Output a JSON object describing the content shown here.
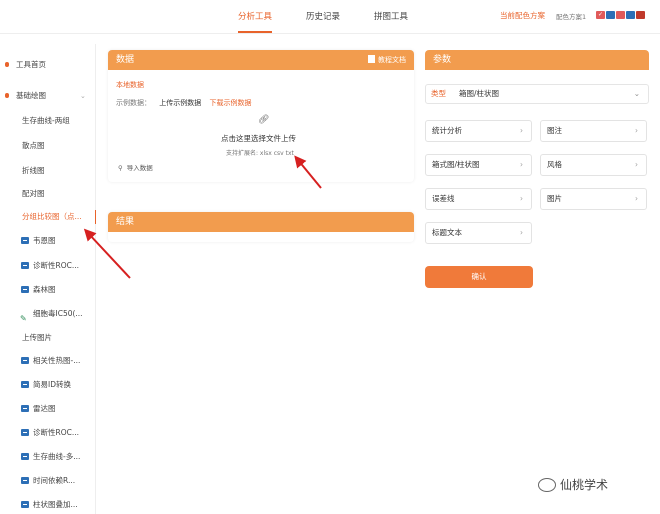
{
  "topnav": {
    "tabs": [
      "分析工具",
      "历史记录",
      "拼图工具"
    ],
    "active_tab": "分析工具",
    "scheme_link": "当前配色方案",
    "scheme_label": "配色方案1",
    "swatch_colors": [
      "#e05a5a",
      "#2d6fb6",
      "#e05a5a",
      "#2d6fb6",
      "#c0392b"
    ]
  },
  "sidebar": {
    "home": "工具首页",
    "group": "基础绘图",
    "items": [
      "生存曲线-两组",
      "散点图",
      "折线图",
      "配对图",
      "分组比较图（点...",
      "韦恩图",
      "诊断性ROC...",
      "森林图",
      "细胞毒IC50(...",
      "上传图片",
      "相关性热图-...",
      "简易ID转换",
      "雷达图",
      "诊断性ROC...",
      "生存曲线-多...",
      "时间依赖R...",
      "柱状图叠加..."
    ]
  },
  "data_panel": {
    "title": "数据",
    "docs": "教程文档",
    "local_data": "本地数据",
    "sample_label": "示例数据：",
    "upload_sample": "上传示例数据",
    "download_sample": "下载示例数据",
    "upload_text": "点击这里选择文件上传",
    "ext_text": "支持扩展名: xlsx csv txt",
    "import": "导入数据"
  },
  "result_panel": {
    "title": "结果"
  },
  "params_panel": {
    "title": "参数",
    "type_label": "类型",
    "type_value": "箱图/柱状图",
    "buttons": [
      "统计分析",
      "图注",
      "箱式图/柱状图",
      "风格",
      "误差线",
      "图片",
      "标题文本"
    ]
  },
  "confirm": "确认",
  "watermark": "仙桃学术",
  "icons": {
    "docs": "document-icon",
    "upload": "paperclip-icon",
    "import": "link-icon",
    "chevron": "chevron-down-icon",
    "arrow": "chevron-right-icon"
  },
  "colors": {
    "accent": "#e8632b",
    "header": "#f29c4e",
    "confirm": "#f07a3a"
  }
}
